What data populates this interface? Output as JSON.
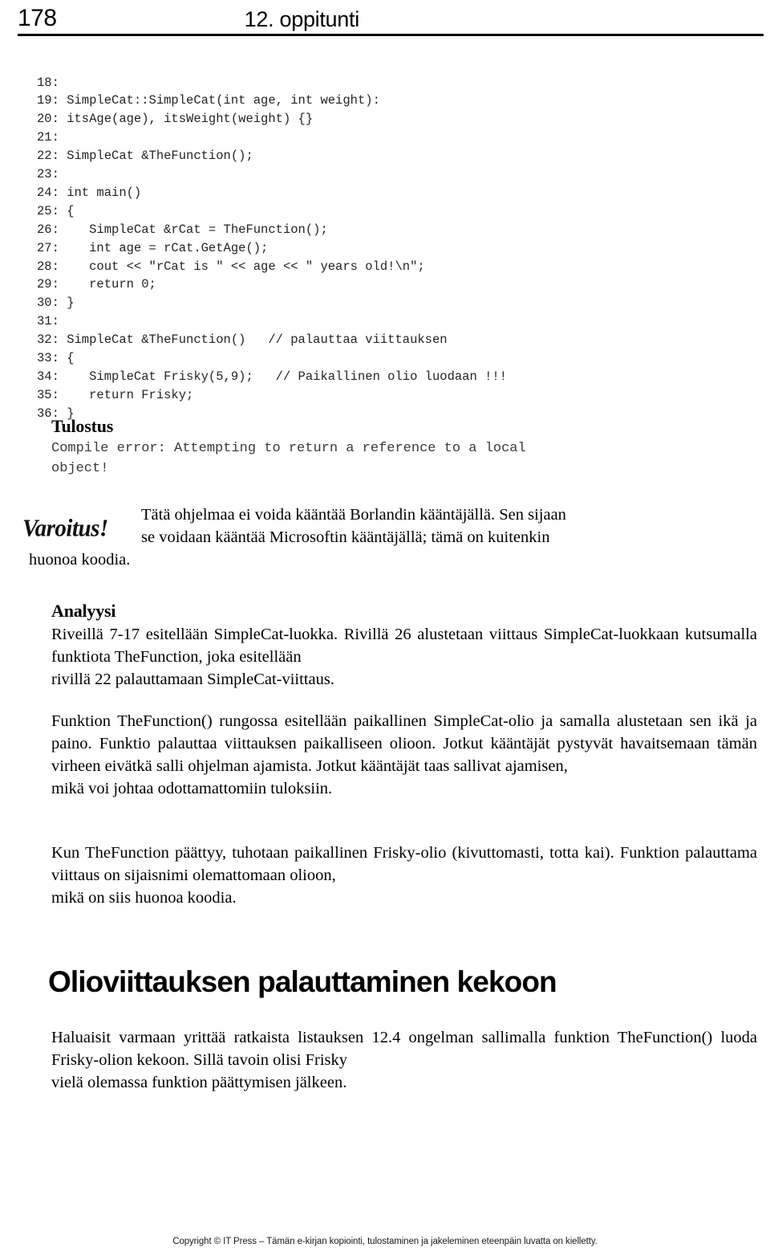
{
  "header": {
    "page_number": "178",
    "running_title": "12. oppitunti"
  },
  "code_listing": {
    "text": "18:\n19: SimpleCat::SimpleCat(int age, int weight):\n20: itsAge(age), itsWeight(weight) {}\n21:\n22: SimpleCat &TheFunction();\n23:\n24: int main()\n25: {\n26:    SimpleCat &rCat = TheFunction();\n27:    int age = rCat.GetAge();\n28:    cout << \"rCat is \" << age << \" years old!\\n\";\n29:    return 0;\n30: }\n31:\n32: SimpleCat &TheFunction()   // palauttaa viittauksen\n33: {\n34:    SimpleCat Frisky(5,9);   // Paikallinen olio luodaan !!!\n35:    return Frisky;\n36: }"
  },
  "output_section": {
    "heading": "Tulostus",
    "line1": "Compile error: Attempting to return a reference to a local",
    "line2": "object!"
  },
  "warning_note": {
    "icon_label": "Varoitus!",
    "line1": "Tätä ohjelmaa ei voida kääntää Borlandin kääntäjällä. Sen sijaan",
    "line2": "se voidaan kääntää Microsoftin kääntäjällä; tämä on kuitenkin",
    "line3": "huonoa koodia."
  },
  "analysis_section": {
    "heading": "Analyysi",
    "paragraph1": "Riveillä 7-17 esitellään SimpleCat-luokka. Rivillä 26 alustetaan viittaus SimpleCat-luokkaan kutsumalla funktiota TheFunction, joka esitellään",
    "paragraph1_last": "rivillä 22 palauttamaan SimpleCat-viittaus.",
    "paragraph2": "Funktion TheFunction() rungossa esitellään paikallinen SimpleCat-olio ja samalla alustetaan sen ikä ja paino. Funktio palauttaa viittauksen paikalliseen olioon. Jotkut kääntäjät pystyvät havaitsemaan tämän virheen eivätkä salli ohjelman ajamista. Jotkut kääntäjät taas sallivat ajamisen,",
    "paragraph2_last": "mikä voi johtaa odottamattomiin tuloksiin.",
    "paragraph3": "Kun TheFunction päättyy, tuhotaan paikallinen Frisky-olio (kivuttomasti, totta kai). Funktion palauttama viittaus on sijaisnimi olemattomaan olioon,",
    "paragraph3_last": "mikä on siis huonoa koodia."
  },
  "section": {
    "heading": "Olioviittauksen palauttaminen kekoon",
    "paragraph": "Haluaisit varmaan yrittää ratkaista listauksen 12.4 ongelman sallimalla funktion TheFunction() luoda Frisky-olion kekoon. Sillä tavoin olisi Frisky",
    "paragraph_last": "vielä olemassa funktion päättymisen jälkeen."
  },
  "footer": {
    "copyright": "Copyright © IT Press – Tämän e-kirjan kopiointi, tulostaminen ja jakeleminen eteenpäin luvatta on kielletty."
  }
}
